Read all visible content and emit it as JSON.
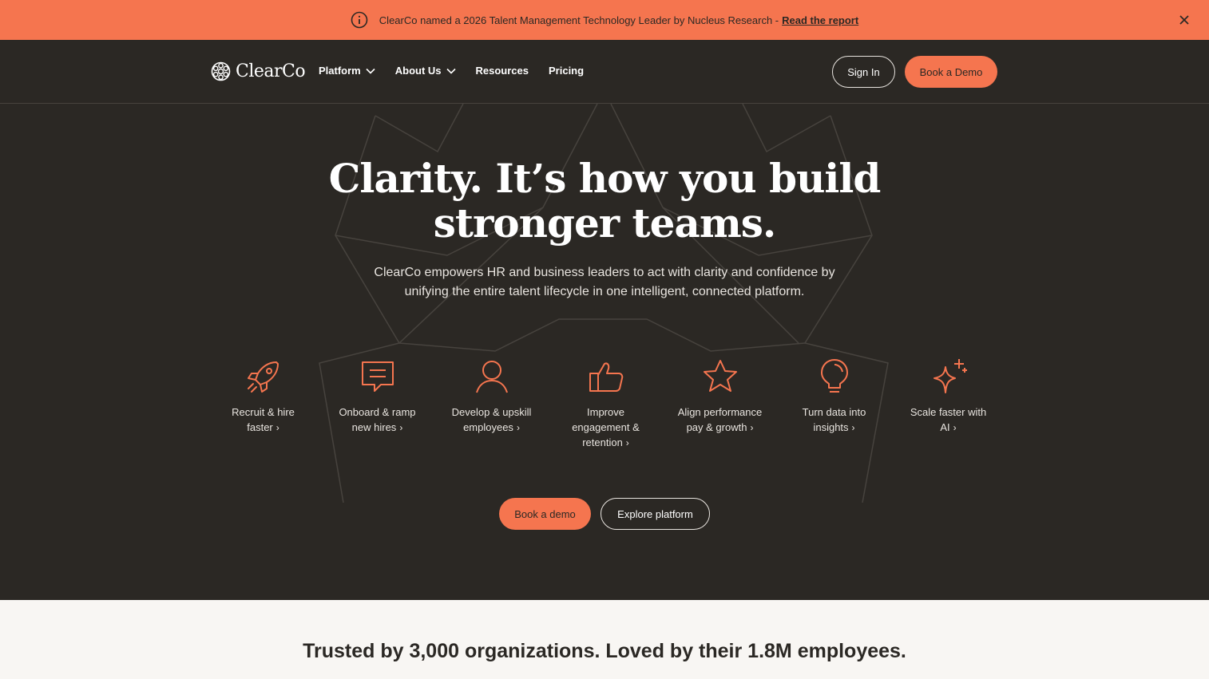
{
  "banner": {
    "icon": "info-icon",
    "text": "ClearCo named a 2026 Talent Management Technology Leader by Nucleus Research -",
    "link": "Read the report",
    "close_icon": "close-icon"
  },
  "nav": {
    "logo": "ClearCo",
    "links": [
      {
        "label": "Platform",
        "dropdown": true
      },
      {
        "label": "About Us",
        "dropdown": true
      },
      {
        "label": "Resources",
        "dropdown": false
      },
      {
        "label": "Pricing",
        "dropdown": false
      }
    ],
    "signin": "Sign In",
    "book_demo": "Book a Demo"
  },
  "hero": {
    "title_line1": "Clarity. It’s how you build",
    "title_line2": "stronger teams.",
    "subtitle": "ClearCo empowers HR and business leaders to act with clarity and confidence by unifying the entire talent lifecycle in one intelligent, connected platform.",
    "features": [
      {
        "label": "Recruit & hire faster",
        "icon": "rocket-icon"
      },
      {
        "label": "Onboard & ramp new hires",
        "icon": "chat-icon"
      },
      {
        "label": "Develop & upskill employees",
        "icon": "person-icon"
      },
      {
        "label": "Improve engagement & retention",
        "icon": "thumbs-up-icon"
      },
      {
        "label": "Align performance pay & growth",
        "icon": "star-icon"
      },
      {
        "label": "Turn data into insights",
        "icon": "lightbulb-icon"
      },
      {
        "label": "Scale faster with AI",
        "icon": "sparkle-icon"
      }
    ],
    "cta_demo": "Book a demo",
    "cta_explore": "Explore platform"
  },
  "trusted": {
    "text": "Trusted by 3,000 organizations. Loved by their 1.8M employees."
  },
  "colors": {
    "accent": "#f5754f",
    "dark_bg": "#2b2824",
    "light_bg": "#f8f6f3"
  }
}
